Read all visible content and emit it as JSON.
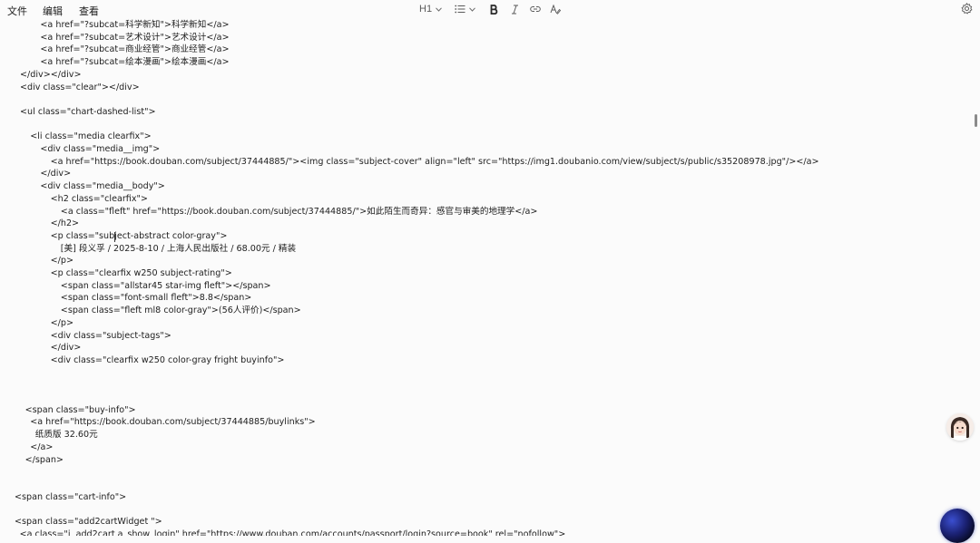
{
  "menu": {
    "file": "文件",
    "edit": "编辑",
    "view": "查看"
  },
  "toolbar": {
    "heading": "H1",
    "list_icon": "bulleted-list-icon",
    "bold_icon": "bold-icon",
    "italic_icon": "italic-icon",
    "link_icon": "link-icon",
    "clear_format_icon": "clear-format-icon",
    "settings_icon": "gear-icon"
  },
  "editor": {
    "lines": [
      "        <a href=\"?subcat=科学新知\">科学新知</a>",
      "        <a href=\"?subcat=艺术设计\">艺术设计</a>",
      "        <a href=\"?subcat=商业经管\">商业经管</a>",
      "        <a href=\"?subcat=绘本漫画\">绘本漫画</a>",
      "</div></div>",
      "<div class=\"clear\"></div>",
      "",
      "<ul class=\"chart-dashed-list\">",
      "",
      "    <li class=\"media clearfix\">",
      "        <div class=\"media__img\">",
      "            <a href=\"https://book.douban.com/subject/37444885/\"><img class=\"subject-cover\" align=\"left\" src=\"https://img1.doubanio.com/view/subject/s/public/s35208978.jpg\"/></a>",
      "        </div>",
      "        <div class=\"media__body\">",
      "            <h2 class=\"clearfix\">",
      "                <a class=\"fleft\" href=\"https://book.douban.com/subject/37444885/\">如此陌生而奇异：感官与审美的地理学</a>",
      "            </h2>",
      "            <p class=\"subject-abstract color-gray\">",
      "                [美] 段义孚 / 2025-8-10 / 上海人民出版社 / 68.00元 / 精装",
      "            </p>",
      "            <p class=\"clearfix w250 subject-rating\">",
      "                <span class=\"allstar45 star-img fleft\"></span>",
      "                <span class=\"font-small fleft\">8.8</span>",
      "                <span class=\"fleft ml8 color-gray\">(56人评价)</span>",
      "            </p>",
      "            <div class=\"subject-tags\">",
      "            </div>",
      "            <div class=\"clearfix w250 color-gray fright buyinfo\">",
      "",
      "",
      "",
      "  <span class=\"buy-info\">",
      "    <a href=\"https://book.douban.com/subject/37444885/buylinks\">",
      "      纸质版 32.60元",
      "    </a>",
      "  </span>",
      "",
      "",
      "<span class=\"cart-info\">",
      "",
      "<span class=\"add2cartWidget \">",
      "  <a class=\"j  add2cart a_show_login\" href=\"https://www.douban.com/accounts/passport/login?source=book\" rel=\"nofollow\">"
    ]
  },
  "colors": {
    "background": "#fbfbfb",
    "text": "#1e1e1e",
    "toolbar_icon": "#5a5a5a"
  }
}
